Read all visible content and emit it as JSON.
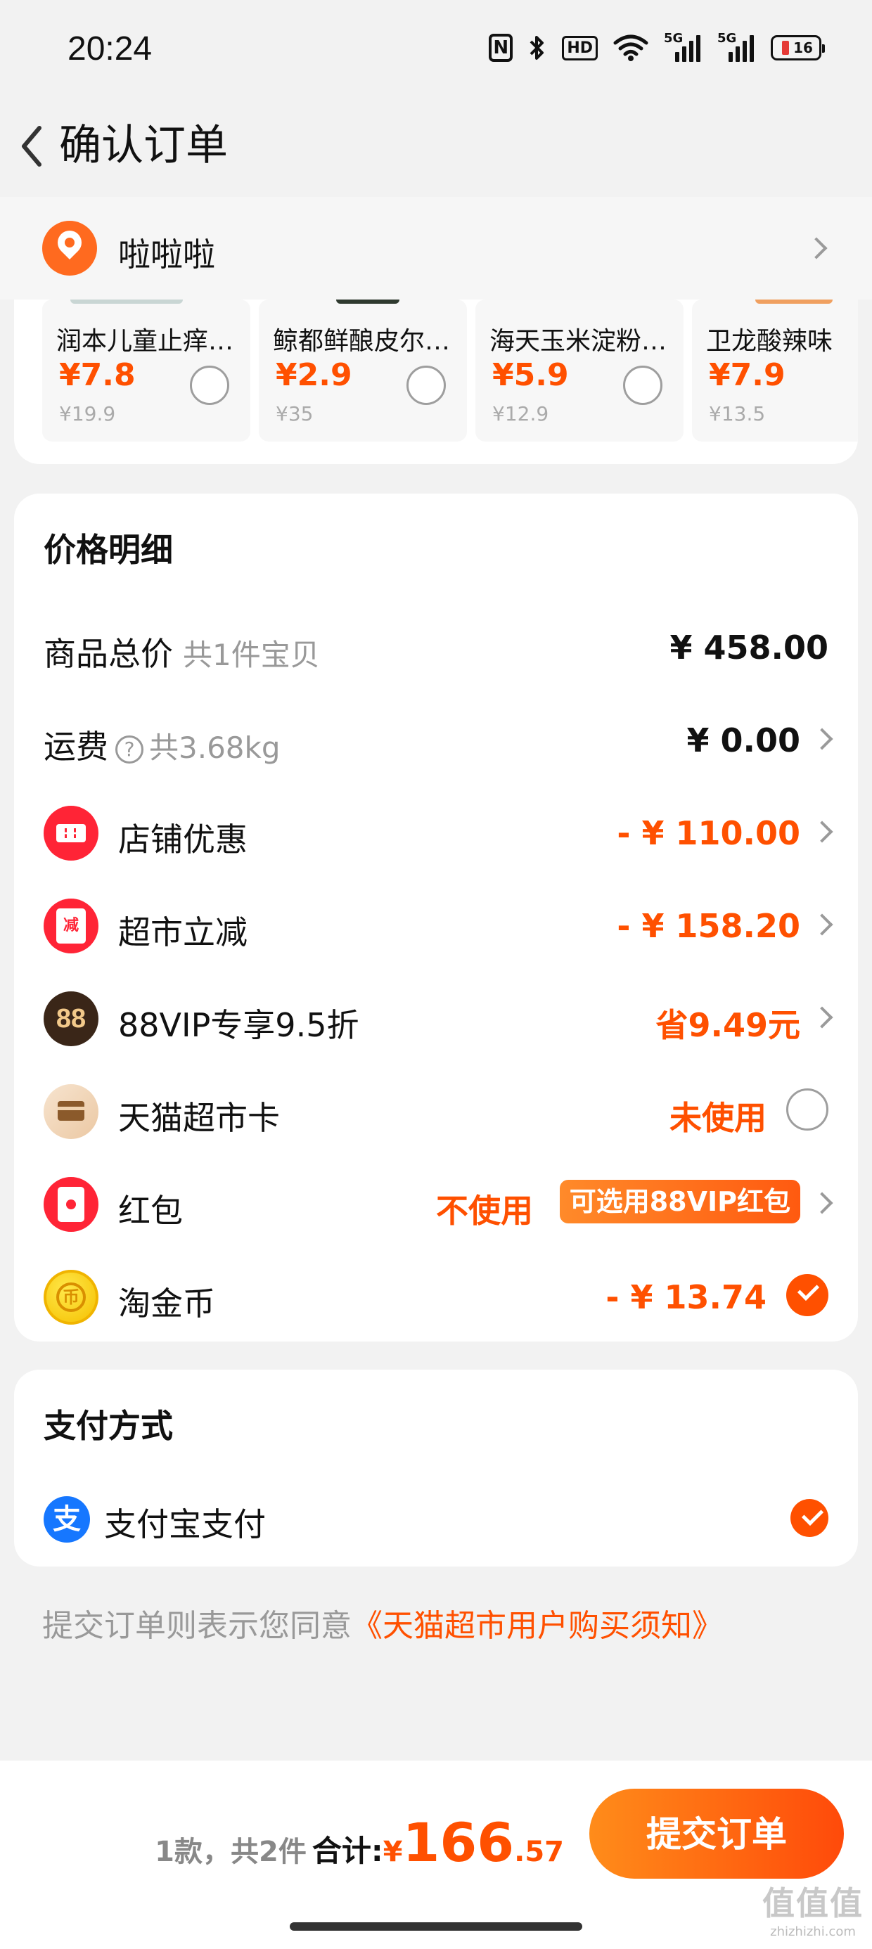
{
  "status_bar": {
    "time": "20:24",
    "icons": [
      "nfc-icon",
      "bluetooth-icon",
      "hd-icon",
      "wifi-icon",
      "signal-5g-icon",
      "signal-5g-icon",
      "battery-icon"
    ],
    "hd_label": "HD",
    "signal_label": "5G",
    "battery_level": "16",
    "battery_color": "#e53935"
  },
  "nav": {
    "title": "确认订单"
  },
  "address": {
    "name": "啦啦啦"
  },
  "recommendations": [
    {
      "name": "润本儿童止痒…",
      "price": "¥7.8",
      "original": "¥19.9"
    },
    {
      "name": "鲸都鲜酿皮尔…",
      "price": "¥2.9",
      "original": "¥35"
    },
    {
      "name": "海天玉米淀粉…",
      "price": "¥5.9",
      "original": "¥12.9"
    },
    {
      "name": "卫龙酸辣味",
      "price": "¥7.9",
      "original": "¥13.5"
    }
  ],
  "price_details": {
    "title": "价格明细",
    "goods_total_label": "商品总价",
    "goods_total_sub": "共1件宝贝",
    "goods_total_value": "¥ 458.00",
    "shipping_label": "运费",
    "shipping_sub": "共3.68kg",
    "shipping_value": "¥ 0.00",
    "shop_discount_label": "店铺优惠",
    "shop_discount_value": "- ¥ 110.00",
    "market_reduction_label": "超市立减",
    "market_reduction_icon_text": "减",
    "market_reduction_value": "- ¥ 158.20",
    "vip_label": "88VIP专享9.5折",
    "vip_icon_text": "88",
    "vip_value": "省9.49元",
    "market_card_label": "天猫超市卡",
    "market_card_value": "未使用",
    "red_packet_label": "红包",
    "red_packet_value": "不使用",
    "red_packet_tag": "可选用88VIP红包",
    "coin_label": "淘金币",
    "coin_icon_text": "币",
    "coin_value": "- ¥ 13.74"
  },
  "payment": {
    "title": "支付方式",
    "method_label": "支付宝支付",
    "method_icon_text": "支"
  },
  "agreement": {
    "text": "提交订单则表示您同意",
    "link": "《天猫超市用户购买须知》"
  },
  "bottom_bar": {
    "count": "1款，共2件",
    "total_label": "合计:",
    "currency": "¥",
    "total_integer": "166",
    "total_decimal": ".57",
    "submit_label": "提交订单"
  },
  "watermark": {
    "main": "值值值",
    "sub": "zhizhizhi.com"
  },
  "colors": {
    "accent": "#ff5000",
    "page_bg": "#f2f2f2",
    "card_bg": "#ffffff",
    "muted_text": "#999999"
  }
}
